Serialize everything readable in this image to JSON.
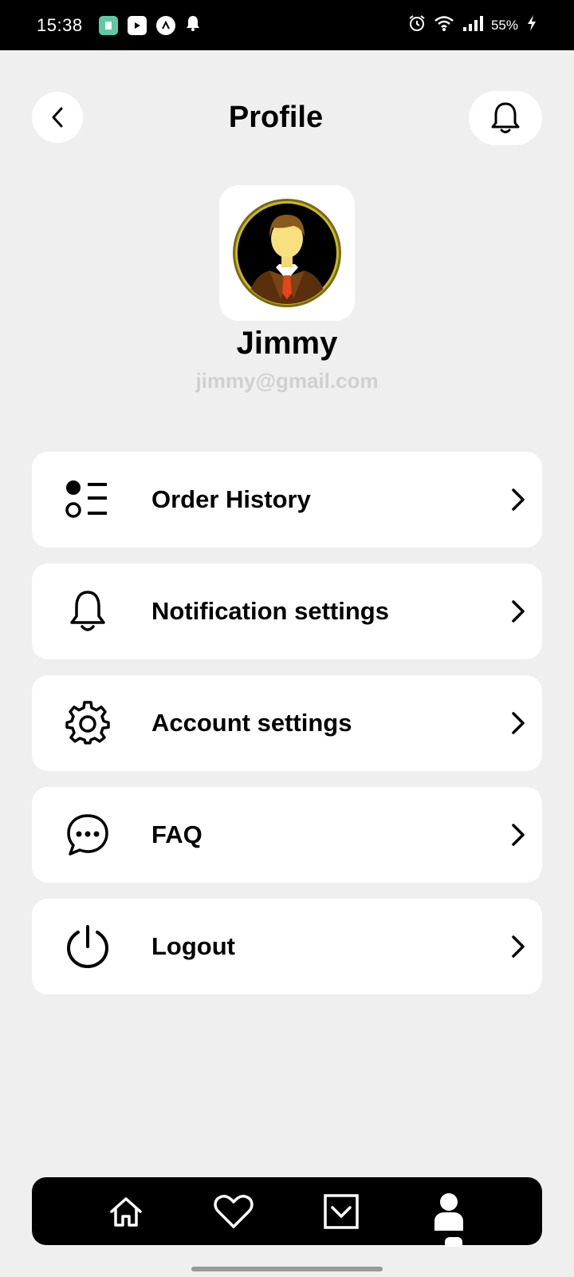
{
  "status_bar": {
    "time": "15:38",
    "battery": "55%",
    "left_icons": [
      "app-icon",
      "youtube-icon",
      "app-circle-icon",
      "notification-bell-icon"
    ],
    "right_icons": [
      "alarm-icon",
      "wifi-icon",
      "signal-icon",
      "charging-icon"
    ]
  },
  "header": {
    "title": "Profile",
    "back_icon": "chevron-left-icon",
    "bell_icon": "bell-icon"
  },
  "profile": {
    "name": "Jimmy",
    "email": "jimmy@gmail.com",
    "avatar": "avatar-businessman"
  },
  "menu": [
    {
      "label": "Order History",
      "icon": "list-icon"
    },
    {
      "label": "Notification settings",
      "icon": "bell-icon"
    },
    {
      "label": "Account settings",
      "icon": "gear-icon"
    },
    {
      "label": "FAQ",
      "icon": "chat-bubble-icon"
    },
    {
      "label": "Logout",
      "icon": "power-icon"
    }
  ],
  "bottom_nav": [
    {
      "icon": "home-icon",
      "active": false
    },
    {
      "icon": "heart-icon",
      "active": false
    },
    {
      "icon": "checkbox-down-icon",
      "active": false
    },
    {
      "icon": "user-icon",
      "active": true
    }
  ],
  "colors": {
    "background": "#efefef",
    "card": "#ffffff",
    "text": "#000000",
    "email": "#d0d0d0",
    "nav_bar": "#000000"
  }
}
